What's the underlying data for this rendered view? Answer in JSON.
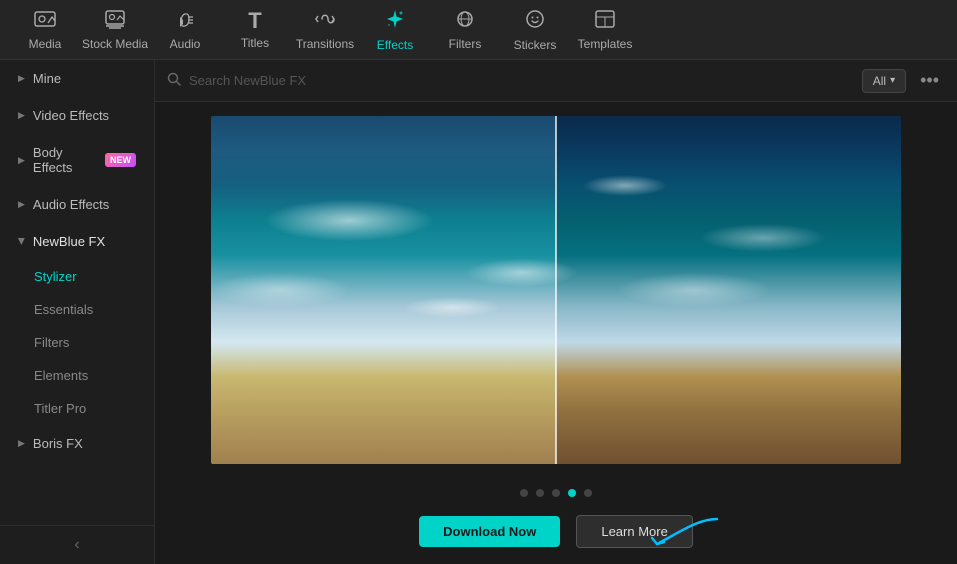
{
  "toolbar": {
    "items": [
      {
        "id": "media",
        "label": "Media",
        "icon": "🖼",
        "active": false
      },
      {
        "id": "stock-media",
        "label": "Stock Media",
        "icon": "📷",
        "active": false
      },
      {
        "id": "audio",
        "label": "Audio",
        "icon": "🎵",
        "active": false
      },
      {
        "id": "titles",
        "label": "Titles",
        "icon": "T",
        "active": false
      },
      {
        "id": "transitions",
        "label": "Transitions",
        "icon": "⚡",
        "active": false
      },
      {
        "id": "effects",
        "label": "Effects",
        "icon": "✦",
        "active": true
      },
      {
        "id": "filters",
        "label": "Filters",
        "icon": "◈",
        "active": false
      },
      {
        "id": "stickers",
        "label": "Stickers",
        "icon": "🎭",
        "active": false
      },
      {
        "id": "templates",
        "label": "Templates",
        "icon": "⊞",
        "active": false
      }
    ]
  },
  "sidebar": {
    "items": [
      {
        "id": "mine",
        "label": "Mine",
        "type": "section",
        "expanded": false
      },
      {
        "id": "video-effects",
        "label": "Video Effects",
        "type": "section",
        "expanded": false
      },
      {
        "id": "body-effects",
        "label": "Body Effects",
        "type": "section",
        "expanded": false,
        "badge": "NEW"
      },
      {
        "id": "audio-effects",
        "label": "Audio Effects",
        "type": "section",
        "expanded": false
      },
      {
        "id": "newblue-fx",
        "label": "NewBlue FX",
        "type": "section",
        "expanded": true
      },
      {
        "id": "boris-fx",
        "label": "Boris FX",
        "type": "section",
        "expanded": false
      }
    ],
    "newblue_sub": [
      {
        "id": "stylizer",
        "label": "Stylizer",
        "active": true
      },
      {
        "id": "essentials",
        "label": "Essentials",
        "active": false
      },
      {
        "id": "filters",
        "label": "Filters",
        "active": false
      },
      {
        "id": "elements",
        "label": "Elements",
        "active": false
      },
      {
        "id": "titler-pro",
        "label": "Titler Pro",
        "active": false
      }
    ],
    "collapse_label": "‹"
  },
  "search": {
    "placeholder": "Search NewBlue FX",
    "filter_label": "All",
    "more_label": "•••"
  },
  "pagination": {
    "dots": [
      {
        "active": false
      },
      {
        "active": false
      },
      {
        "active": false
      },
      {
        "active": true
      },
      {
        "active": false
      }
    ]
  },
  "buttons": {
    "download": "Download Now",
    "learn_more": "Learn More"
  },
  "colors": {
    "accent": "#00d4c8",
    "new_badge_start": "#ff6b9d",
    "new_badge_end": "#c44dff"
  }
}
